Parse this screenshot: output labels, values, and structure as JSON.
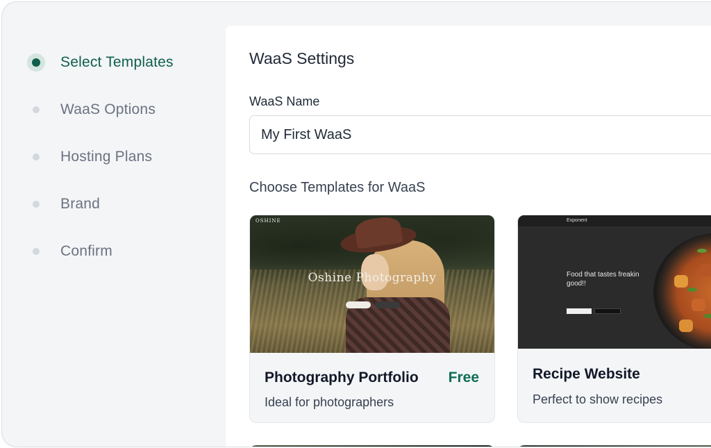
{
  "steps": [
    {
      "label": "Select Templates",
      "active": true
    },
    {
      "label": "WaaS Options",
      "active": false
    },
    {
      "label": "Hosting Plans",
      "active": false
    },
    {
      "label": "Brand",
      "active": false
    },
    {
      "label": "Confirm",
      "active": false
    }
  ],
  "panel": {
    "title": "WaaS Settings",
    "name_label": "WaaS Name",
    "name_value": "My First WaaS",
    "templates_heading": "Choose Templates for WaaS"
  },
  "templates": [
    {
      "title": "Photography Portfolio",
      "description": "Ideal for photographers",
      "price": "Free",
      "thumb_title": "Oshine Photography",
      "thumb_brand": "OSHINE"
    },
    {
      "title": "Recipe Website",
      "description": "Perfect to show recipes",
      "thumb_logo": "Exponent",
      "thumb_headline": "Food that tastes freakin good!!"
    }
  ],
  "colors": {
    "accent": "#0f5e4c",
    "price": "#0f6e56",
    "sidebar_bg": "#f3f5f7",
    "inactive_text": "#6b7280"
  }
}
